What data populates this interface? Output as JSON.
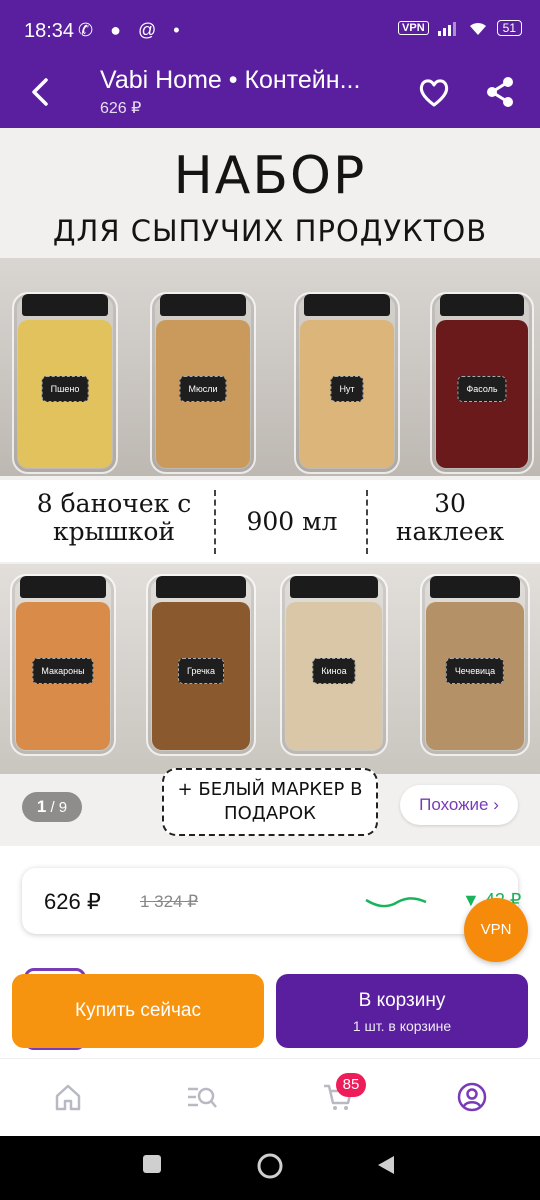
{
  "status_bar": {
    "time": "18:34",
    "notif_icons": "✆ ● @ •",
    "vpn": "VPN",
    "battery": "51"
  },
  "header": {
    "title": "Vabi Home • Контейн...",
    "price": "626 ₽"
  },
  "gallery": {
    "heading": "НАБОР",
    "subheading": "ДЛЯ СЫПУЧИХ ПРОДУКТОВ",
    "top_jars": [
      {
        "label": "Пшено",
        "color": "#e2c25c"
      },
      {
        "label": "Мюсли",
        "color": "#c99a5b"
      },
      {
        "label": "Нут",
        "color": "#dcb57a"
      },
      {
        "label": "Фасоль",
        "color": "#6a1a1a"
      }
    ],
    "features": [
      {
        "text": "8 баночек с крышкой"
      },
      {
        "text": "900 мл"
      },
      {
        "text": "30 наклеек"
      }
    ],
    "bottom_jars": [
      {
        "label": "Макароны",
        "color": "#d98c4a"
      },
      {
        "label": "Гречка",
        "color": "#8a5a2e"
      },
      {
        "label": "Киноа",
        "color": "#d9c7a8"
      },
      {
        "label": "Чечевица",
        "color": "#b49166"
      }
    ],
    "gift": "+ БЕЛЫЙ МАРКЕР В ПОДАРОК",
    "counter_current": "1",
    "counter_total": "/ 9",
    "similar": "Похожие ›"
  },
  "price_card": {
    "current": "626 ₽",
    "old": "1 324 ₽",
    "drop": "▼ 42 ₽",
    "trend_color": "#19b35c"
  },
  "vpn_bubble": "VPN",
  "actions": {
    "buy_now": "Купить сейчас",
    "cart": "В корзину",
    "cart_sub": "1 шт. в корзине"
  },
  "bottom_nav": {
    "cart_badge": "85",
    "accent": "#7a3bb8"
  }
}
